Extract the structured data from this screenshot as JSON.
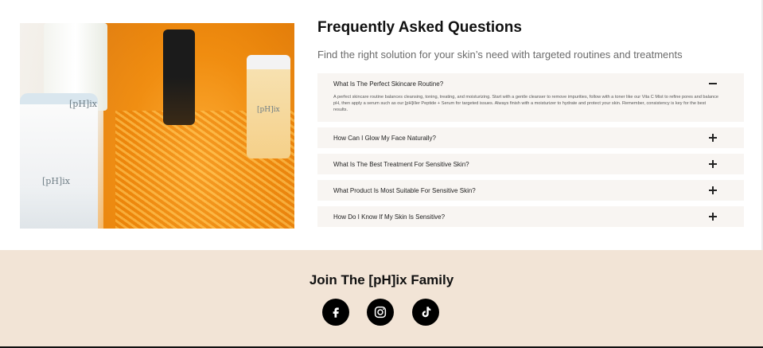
{
  "faq": {
    "title": "Frequently Asked Questions",
    "subtitle": "Find the right solution for your skin’s need with targeted routines and treatments",
    "items": [
      {
        "question": "What Is The Perfect Skincare Routine?",
        "answer": "A perfect skincare routine balances cleansing, toning, treating, and moisturizing. Start with a gentle cleanser to remove impurities, follow with a toner like our Vita C Mist to refine pores and balance pH, then apply a serum such as our [pH]iller Peptide + Serum for targeted issues. Always finish with a moisturizer to hydrate and protect your skin. Remember, consistency is key for the best results.",
        "state": "expanded"
      },
      {
        "question": "How Can I Glow My Face Naturally?",
        "state": "collapsed"
      },
      {
        "question": "What Is The Best Treatment For Sensitive Skin?",
        "state": "collapsed"
      },
      {
        "question": "What Product Is Most Suitable For Sensitive Skin?",
        "state": "collapsed"
      },
      {
        "question": "How Do I Know If My Skin Is Sensitive?",
        "state": "collapsed"
      }
    ]
  },
  "image": {
    "labels": [
      "[pH]ix",
      "[pH]ix",
      "[pH]ix"
    ]
  },
  "footer": {
    "title": "Join The [pH]ix Family",
    "social": [
      {
        "icon": "facebook-icon"
      },
      {
        "icon": "instagram-icon"
      },
      {
        "icon": "tiktok-icon"
      }
    ]
  },
  "colors": {
    "faq_item_bg": "#f8f5f2",
    "footer_bg": "#f2e4d6",
    "accent_orange": "#f28c12"
  }
}
